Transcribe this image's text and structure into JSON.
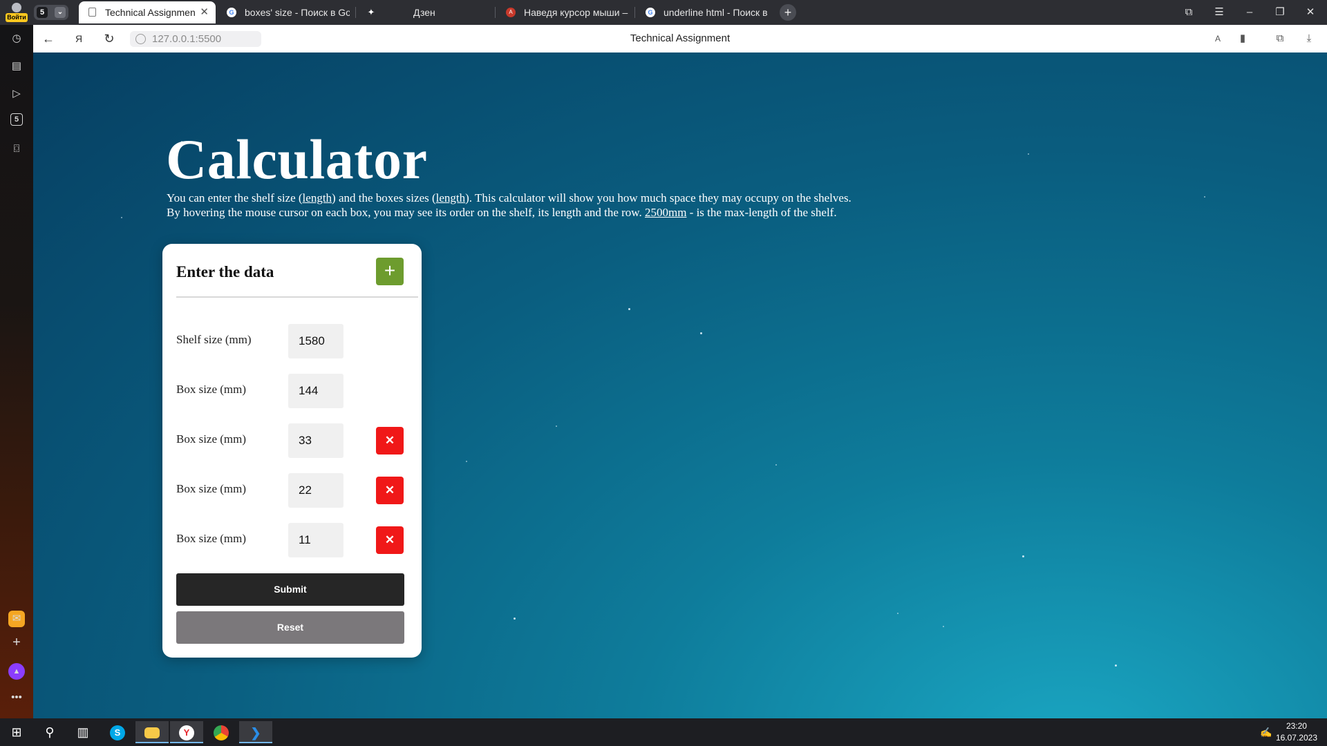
{
  "browser": {
    "profile_label": "Войти",
    "tabgroup_count": "5",
    "tabs": [
      {
        "title": "Technical Assignment",
        "active": true
      },
      {
        "title": "boxes' size - Поиск в Google",
        "active": false
      },
      {
        "title": "Дзен",
        "active": false
      },
      {
        "title": "Наведя курсор мыши – Chrome",
        "active": false
      },
      {
        "title": "underline html - Поиск в Google",
        "active": false
      }
    ],
    "url": "127.0.0.1:5500",
    "page_title": "Technical Assignment"
  },
  "sidepanel": {
    "items": [
      "history-icon",
      "collections-icon",
      "video-icon",
      "tabs-counter-icon",
      "screenshot-icon"
    ],
    "tab_counter": "5"
  },
  "page": {
    "heading": "Calculator",
    "intro_line1": {
      "a": "You can enter the shelf size (",
      "b": "length",
      "c": ") and the boxes sizes (",
      "d": "length",
      "e": "). This calculator will show you how much space they may occupy on the shelves."
    },
    "intro_line2": {
      "a": "By hovering the mouse cursor on each box, you may see its order on the shelf, its length and the row. ",
      "b": "2500mm",
      "c": " - is the max-length of the shelf."
    },
    "card": {
      "title": "Enter the data",
      "add_label": "+",
      "shelf_label": "Shelf size (mm)",
      "shelf_value": "1580",
      "box_label": "Box size (mm)",
      "boxes": [
        "144",
        "33",
        "22",
        "11"
      ],
      "delete_label": "✕",
      "submit_label": "Submit",
      "reset_label": "Reset"
    }
  },
  "taskbar": {
    "time": "23:20",
    "date": "16.07.2023"
  },
  "colors": {
    "add_button": "#6d9c2e",
    "delete_button": "#f01818",
    "submit_button": "#262626",
    "reset_button": "#7b787b"
  }
}
